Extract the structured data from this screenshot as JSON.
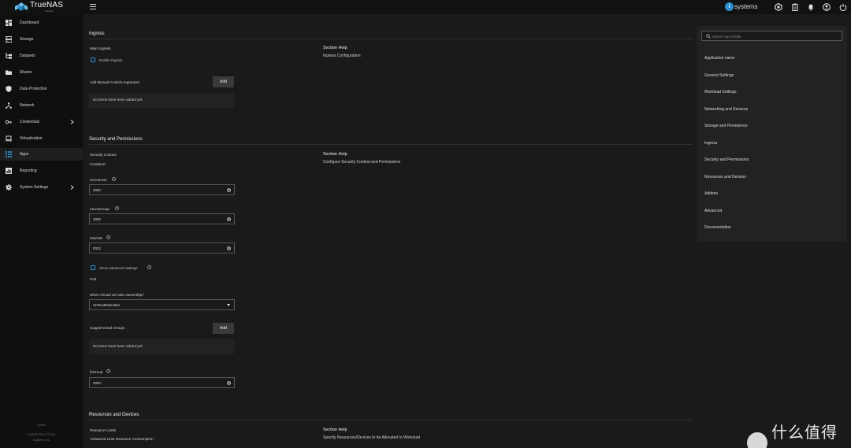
{
  "topbar": {
    "brand": "TrueNAS",
    "brand_sub": "SCALE",
    "partner_logo": "systems",
    "icons": [
      "truecommand-icon",
      "clipboard-icon",
      "bell-icon",
      "account-icon",
      "power-icon"
    ]
  },
  "sidebar": {
    "items": [
      {
        "label": "Dashboard",
        "icon": "dashboard-icon"
      },
      {
        "label": "Storage",
        "icon": "storage-icon"
      },
      {
        "label": "Datasets",
        "icon": "datasets-icon"
      },
      {
        "label": "Shares",
        "icon": "shares-icon"
      },
      {
        "label": "Data Protection",
        "icon": "shield-icon"
      },
      {
        "label": "Network",
        "icon": "network-icon"
      },
      {
        "label": "Credentials",
        "icon": "key-icon",
        "has_children": true
      },
      {
        "label": "Virtualization",
        "icon": "laptop-icon"
      },
      {
        "label": "Apps",
        "icon": "apps-icon",
        "active": true
      },
      {
        "label": "Reporting",
        "icon": "chart-icon"
      },
      {
        "label": "System Settings",
        "icon": "gear-icon",
        "has_children": true
      }
    ],
    "footer": {
      "hostname": "truenas",
      "version": "TrueNAS SCALE ® 2024",
      "company": "iXsystems, Inc."
    }
  },
  "ingress": {
    "title": "Ingress",
    "main_ingress_label": "Main Ingress",
    "enable_ingress_label": "Enable Ingress",
    "section_help_title": "Section Help",
    "section_help_text": "Ingress Configuration",
    "custom_label": "Add Manual Custom Ingresses",
    "add_label": "Add",
    "empty_text": "No items have been added yet."
  },
  "security": {
    "title": "Security and Permissions",
    "security_context_label": "Security Context",
    "container_label": "Container",
    "section_help_title": "Section Help",
    "section_help_text": "Configure Security Context and Permissions",
    "run_as_user_label": "runAsUser",
    "run_as_user_value": "3000",
    "run_as_group_label": "runAsGroup",
    "run_as_group_value": "3000",
    "umask_label": "UMASK",
    "umask_value": "0022",
    "show_advanced_label": "Show Advanced Settings",
    "pod_label": "Pod",
    "ownership_label": "When should we take ownership?",
    "ownership_value": "OnRootMismatch",
    "supplemental_label": "Supplemental Groups",
    "add_label": "Add",
    "empty_text": "No items have been added yet.",
    "fs_group_label": "fsGroup",
    "fs_group_value": "3000"
  },
  "resources": {
    "title": "Resources and Devices",
    "limits_label": "Resource Limits",
    "advanced_limit_label": "Advanced Limit Resource Consumption",
    "section_help_title": "Section Help",
    "section_help_text": "Specify Resources/Devices to be Allocated to Workload"
  },
  "right_panel": {
    "search_placeholder": "Search Input Fields",
    "items": [
      "Application name",
      "General Settings",
      "Workload Settings",
      "Networking and Services",
      "Storage and Persistence",
      "Ingress",
      "Security and Permissions",
      "Resources and Devices",
      "Addons",
      "Advanced",
      "Documentation"
    ]
  },
  "watermark": {
    "text": "什么值得买"
  },
  "colors": {
    "accent": "#2a8fd0",
    "sidebar_bg": "#0f0f0f",
    "main_bg": "#1a1a1a",
    "panel_bg": "#222222"
  }
}
